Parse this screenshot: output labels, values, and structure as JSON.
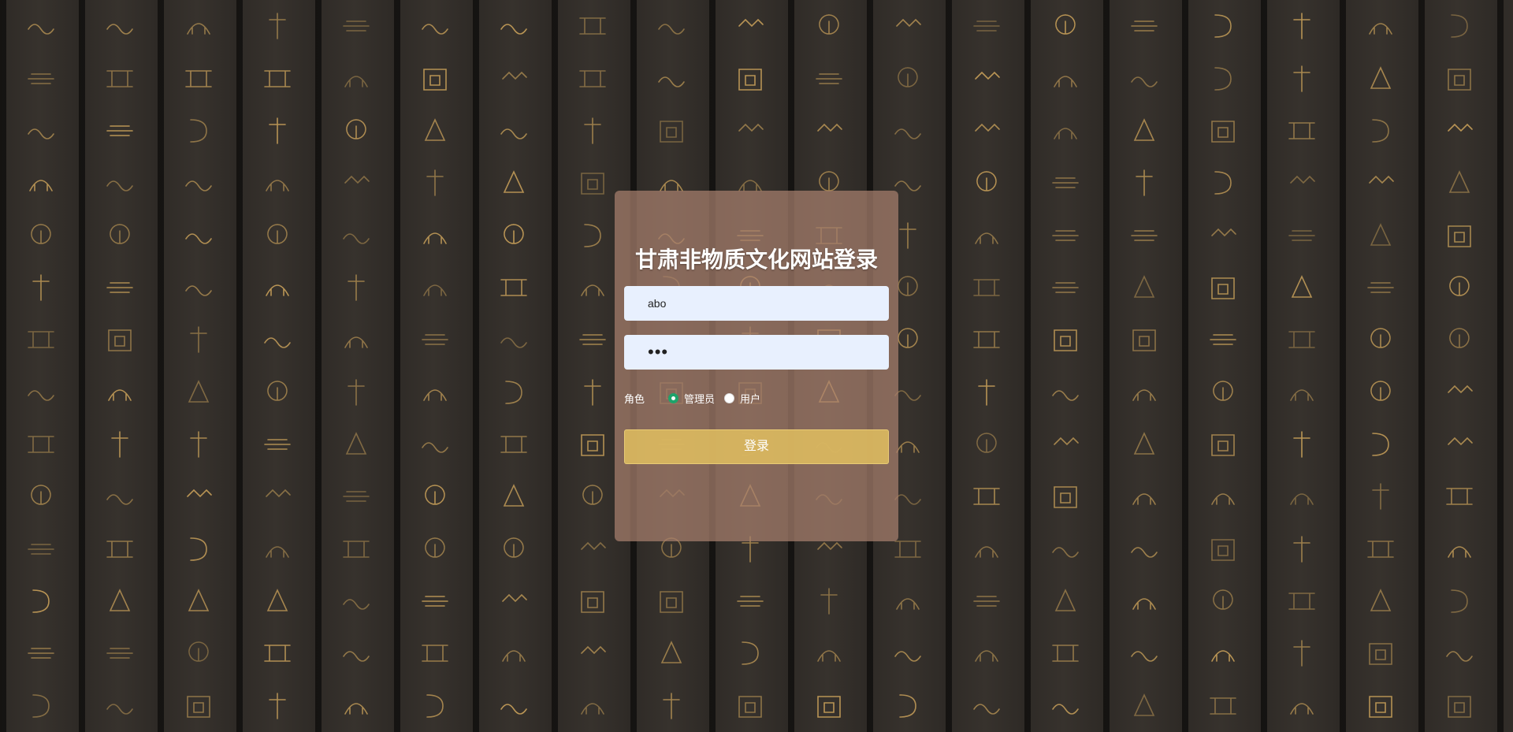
{
  "login": {
    "title": "甘肃非物质文化网站登录",
    "username_value": "abo",
    "password_value": "•••",
    "role_label": "角色",
    "role_options": [
      "管理员",
      "用户"
    ],
    "selected_role": "管理员",
    "submit_label": "登录"
  },
  "colors": {
    "card_bg": "#a8806e",
    "button_bg": "#dab95f",
    "input_bg": "#e8f0fe",
    "radio_checked": "#1ea36b",
    "glyph_gold": "#c9a15a"
  },
  "icons": {
    "background": "hieroglyph-pattern"
  }
}
